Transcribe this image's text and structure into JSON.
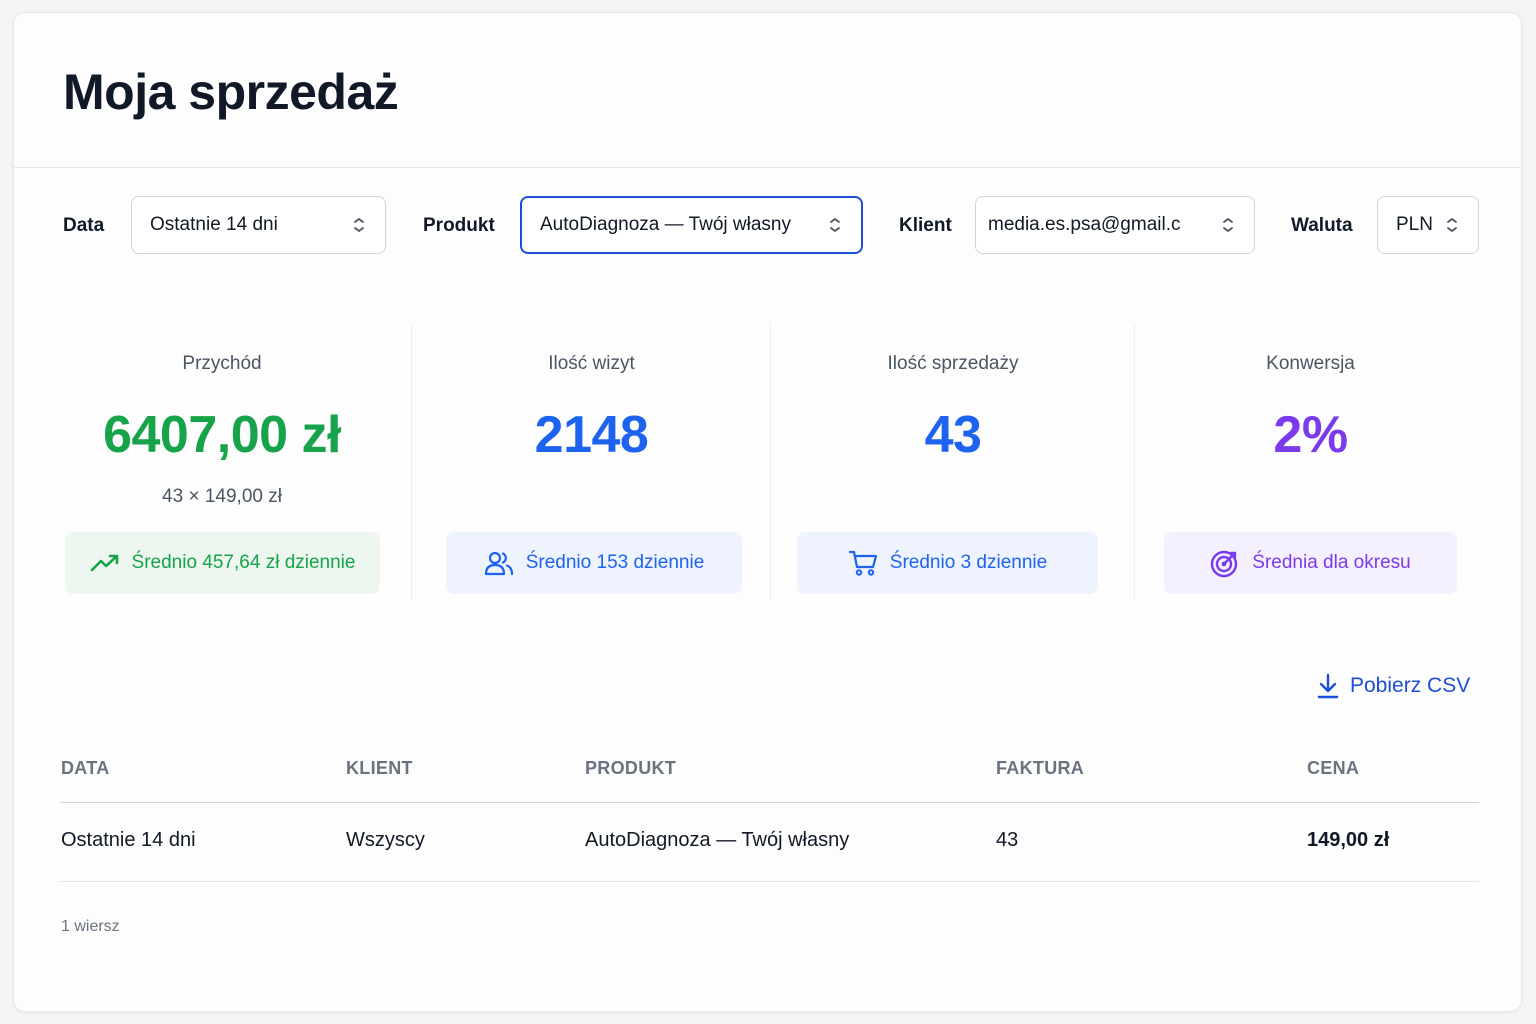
{
  "page": {
    "title": "Moja sprzedaż"
  },
  "filters": [
    {
      "label": "Data",
      "value": "Ostatnie 14 dni"
    },
    {
      "label": "Produkt",
      "value": "AutoDiagnoza — Twój własny"
    },
    {
      "label": "Klient",
      "value": "media.es.psa@gmail.c"
    },
    {
      "label": "Waluta",
      "value": "PLN"
    }
  ],
  "stats": [
    {
      "label": "Przychód",
      "value": "6407,00 zł",
      "sub": "43 × 149,00 zł",
      "chip": "Średnio 457,64 zł dziennie",
      "icon": "trending-up-icon",
      "color": "#16a34a"
    },
    {
      "label": "Ilość wizyt",
      "value": "2148",
      "chip": "Średnio 153 dziennie",
      "icon": "users-icon",
      "color": "#1d63f0"
    },
    {
      "label": "Ilość sprzedaży",
      "value": "43",
      "chip": "Średnio 3 dziennie",
      "icon": "cart-icon",
      "color": "#1d63f0"
    },
    {
      "label": "Konwersja",
      "value": "2%",
      "chip": "Średnia dla okresu",
      "icon": "target-icon",
      "color": "#7c3aed"
    }
  ],
  "actions": {
    "csv_label": "Pobierz CSV"
  },
  "table": {
    "columns": [
      "DATA",
      "KLIENT",
      "PRODUKT",
      "FAKTURA",
      "CENA"
    ],
    "rows": [
      [
        "Ostatnie 14 dni",
        "Wszyscy",
        "AutoDiagnoza — Twój własny",
        "43",
        "149,00 zł"
      ]
    ],
    "row_count": "1 wiersz"
  }
}
